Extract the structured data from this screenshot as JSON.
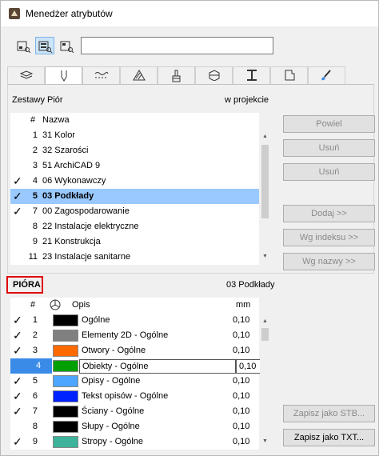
{
  "window": {
    "title": "Menedżer atrybutów"
  },
  "toolbar": {
    "search": {
      "value": ""
    }
  },
  "pen_sets": {
    "title": "Zestawy Piór",
    "filter_label": "w projekcie",
    "columns": {
      "num": "#",
      "name": "Nazwa"
    },
    "rows": [
      {
        "checked": "",
        "num": "1",
        "name": "31 Kolor"
      },
      {
        "checked": "",
        "num": "2",
        "name": "32 Szarości"
      },
      {
        "checked": "",
        "num": "3",
        "name": "51 ArchiCAD 9"
      },
      {
        "checked": "✓",
        "num": "4",
        "name": "06 Wykonawczy"
      },
      {
        "checked": "✓",
        "num": "5",
        "name": "03 Podkłady"
      },
      {
        "checked": "✓",
        "num": "7",
        "name": "00 Zagospodarowanie"
      },
      {
        "checked": "",
        "num": "8",
        "name": "22 Instalacje elektryczne"
      },
      {
        "checked": "",
        "num": "9",
        "name": "21 Konstrukcja"
      },
      {
        "checked": "",
        "num": "11",
        "name": "23 Instalacje sanitarne"
      }
    ],
    "selected_index": 4
  },
  "buttons": {
    "powiel": "Powiel",
    "usun1": "Usuń",
    "usun2": "Usuń",
    "dodaj": "Dodaj >>",
    "wg_indeksu": "Wg indeksu >>",
    "wg_nazwy": "Wg nazwy >>",
    "zapisz_stb": "Zapisz jako STB...",
    "zapisz_txt": "Zapisz jako TXT..."
  },
  "pens": {
    "title": "PIÓRA",
    "current_set": "03 Podkłady",
    "columns": {
      "num": "#",
      "desc": "Opis",
      "mm": "mm"
    },
    "rows": [
      {
        "checked": "✓",
        "num": "1",
        "color": "#000000",
        "desc": "Ogólne",
        "mm": "0,10"
      },
      {
        "checked": "✓",
        "num": "2",
        "color": "#808080",
        "desc": "Elementy 2D - Ogólne",
        "mm": "0,10"
      },
      {
        "checked": "✓",
        "num": "3",
        "color": "#ff6a00",
        "desc": "Otwory - Ogólne",
        "mm": "0,10"
      },
      {
        "checked": "",
        "num": "4",
        "color": "#00a000",
        "desc": "Obiekty - Ogólne",
        "mm": "0,10"
      },
      {
        "checked": "✓",
        "num": "5",
        "color": "#4da6ff",
        "desc": "Opisy - Ogólne",
        "mm": "0,10"
      },
      {
        "checked": "✓",
        "num": "6",
        "color": "#0022ff",
        "desc": "Tekst opisów - Ogólne",
        "mm": "0,10"
      },
      {
        "checked": "✓",
        "num": "7",
        "color": "#000000",
        "desc": "Ściany - Ogólne",
        "mm": "0,10"
      },
      {
        "checked": "",
        "num": "8",
        "color": "#000000",
        "desc": "Słupy - Ogólne",
        "mm": "0,10"
      },
      {
        "checked": "✓",
        "num": "9",
        "color": "#3cb39a",
        "desc": "Stropy - Ogólne",
        "mm": "0,10"
      }
    ],
    "editing_index": 3
  }
}
